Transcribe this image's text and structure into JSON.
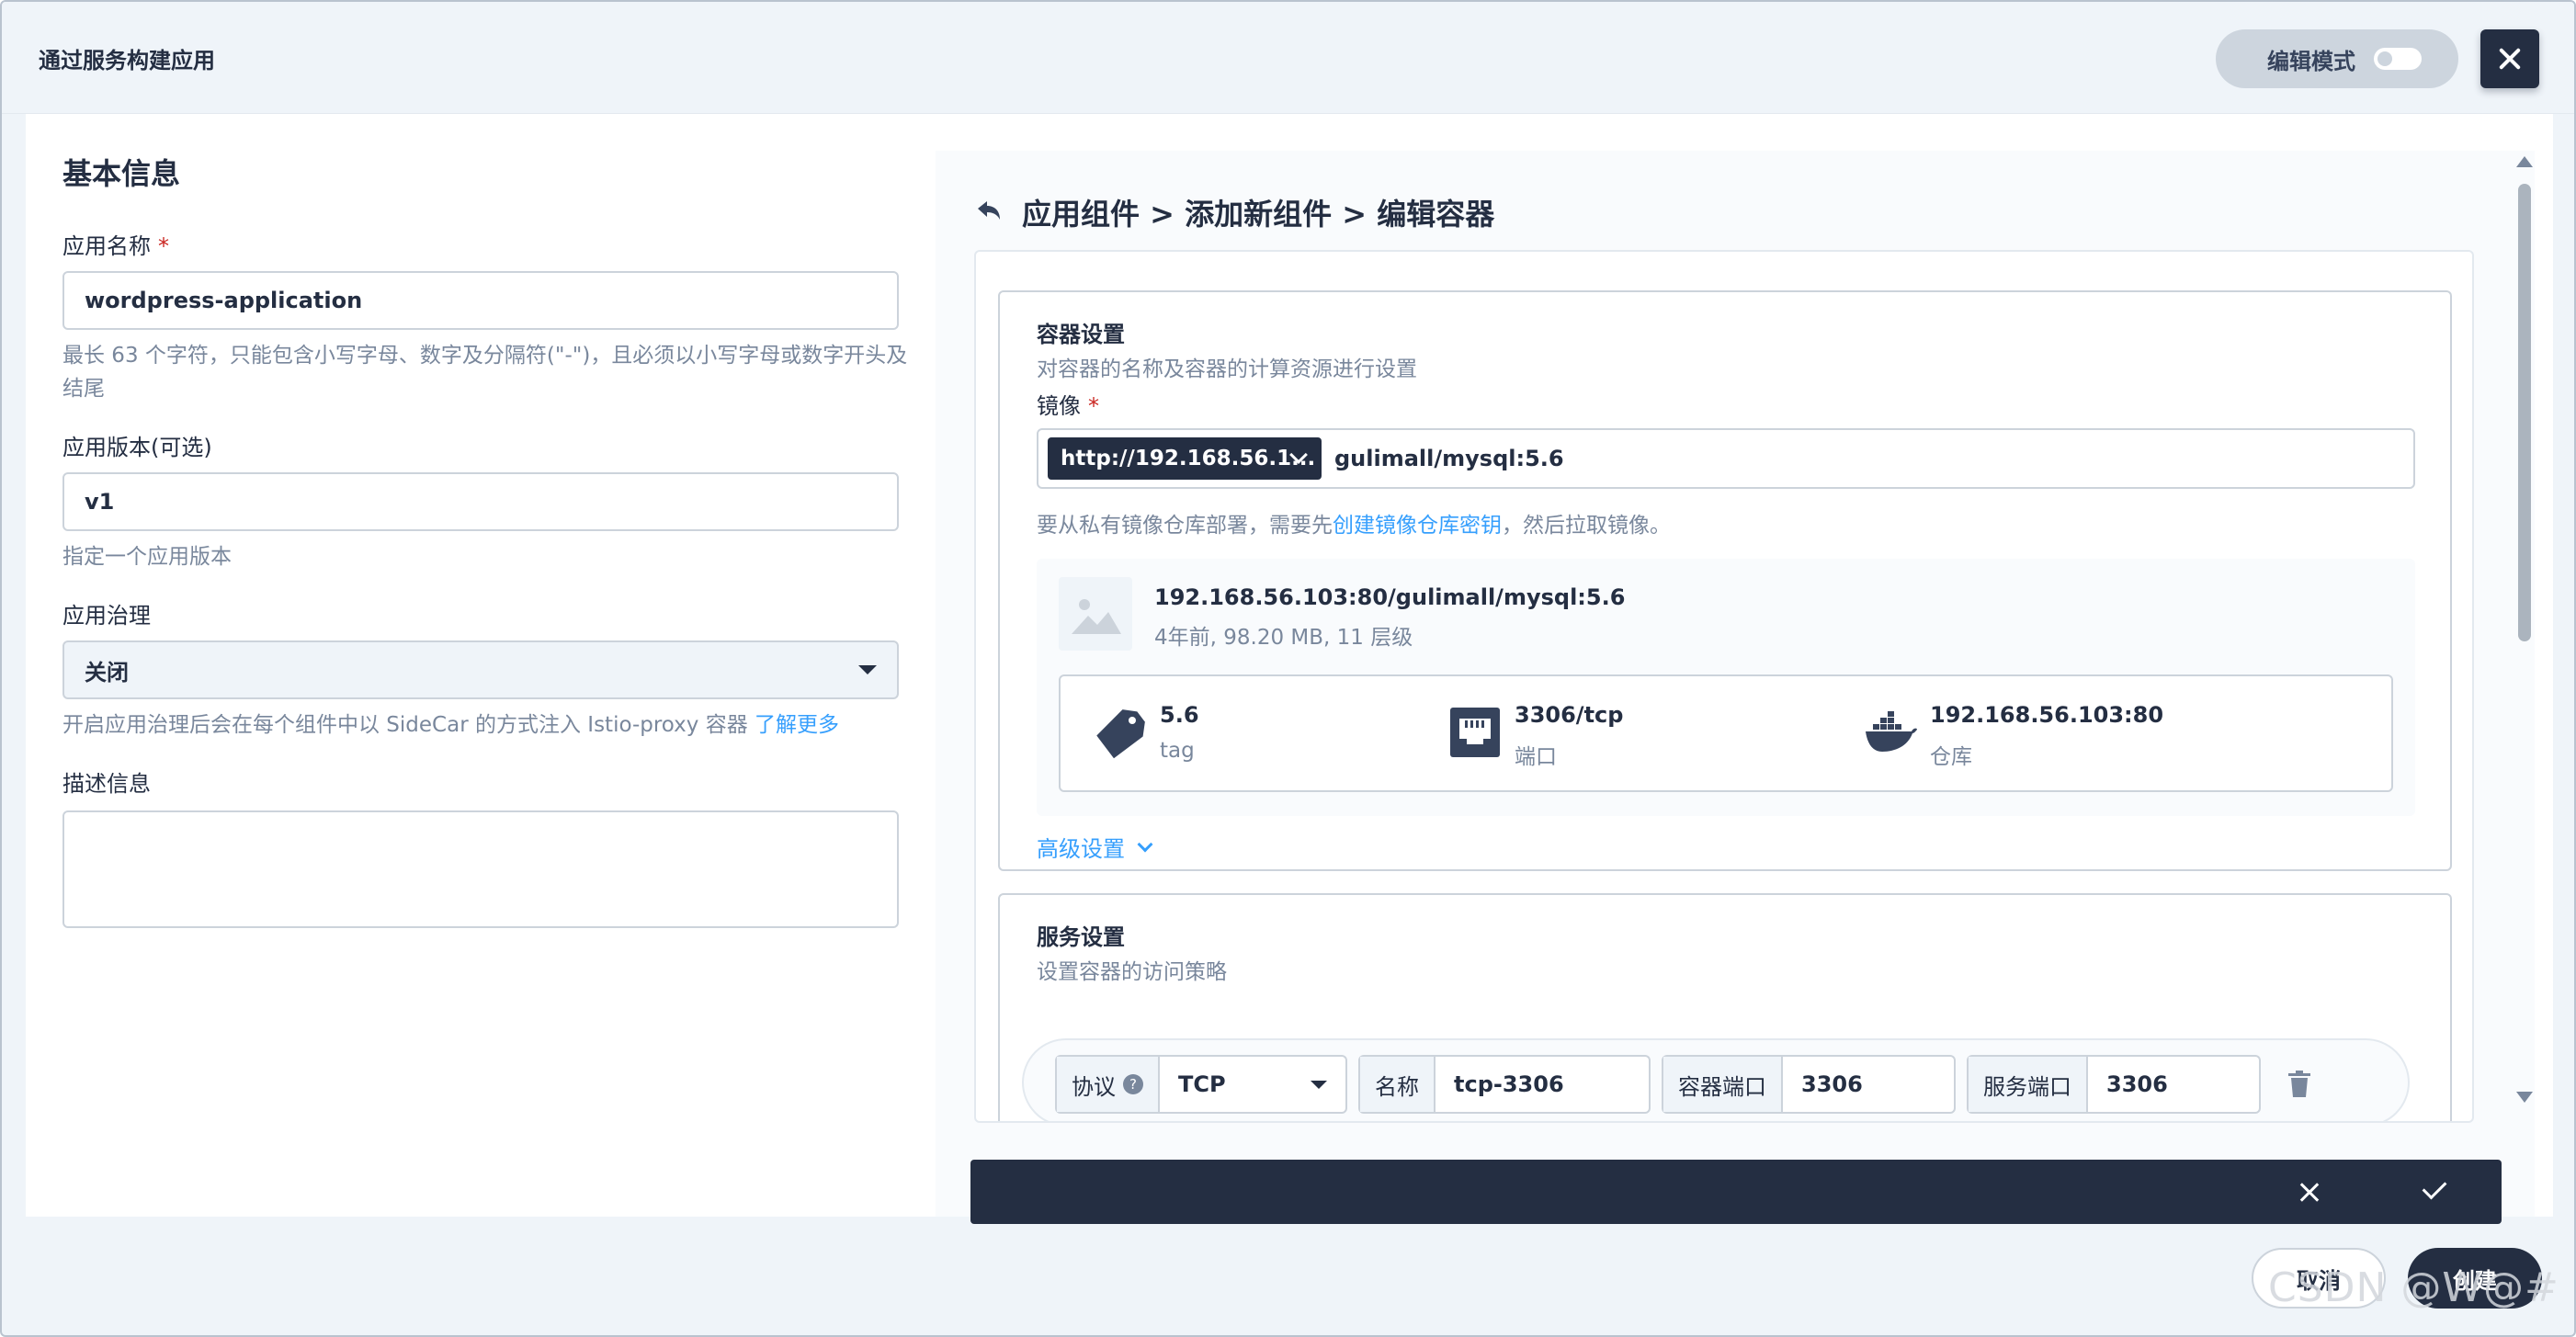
{
  "modal": {
    "title": "通过服务构建应用",
    "edit_mode_label": "编辑模式",
    "edit_mode_on": false
  },
  "left": {
    "section_title": "基本信息",
    "app_name_label": "应用名称",
    "required_mark": "*",
    "app_name_value": "wordpress-application",
    "app_name_hint": "最长 63 个字符，只能包含小写字母、数字及分隔符(\"-\")，且必须以小写字母或数字开头及结尾",
    "version_label": "应用版本(可选)",
    "version_value": "v1",
    "version_hint": "指定一个应用版本",
    "governance_label": "应用治理",
    "governance_value": "关闭",
    "governance_hint": "开启应用治理后会在每个组件中以 SideCar 的方式注入 Istio-proxy 容器",
    "learn_more": "了解更多",
    "desc_label": "描述信息"
  },
  "right": {
    "breadcrumb": "应用组件 > 添加新组件 > 编辑容器",
    "container": {
      "title": "容器设置",
      "desc": "对容器的名称及容器的计算资源进行设置",
      "image_label": "镜像",
      "registry": "http://192.168.56.1...",
      "image_value": "gulimall/mysql:5.6",
      "hint_prefix": "要从私有镜像仓库部署，需要先",
      "hint_link": "创建镜像仓库密钥",
      "hint_suffix": "，然后拉取镜像。",
      "image_full": "192.168.56.103:80/gulimall/mysql:5.6",
      "image_meta": "4年前, 98.20 MB, 11 层级",
      "tag_value": "5.6",
      "tag_key": "tag",
      "port_value": "3306/tcp",
      "port_key": "端口",
      "repo_value": "192.168.56.103:80",
      "repo_key": "仓库",
      "advanced": "高级设置"
    },
    "service": {
      "title": "服务设置",
      "desc": "设置容器的访问策略",
      "protocol_label": "协议",
      "protocol_help": "?",
      "protocol_value": "TCP",
      "name_label": "名称",
      "name_value": "tcp-3306",
      "container_port_label": "容器端口",
      "container_port_value": "3306",
      "service_port_label": "服务端口",
      "service_port_value": "3306"
    }
  },
  "footer": {
    "cancel": "取消",
    "create": "创建",
    "watermark": "CSDN @W@#"
  }
}
